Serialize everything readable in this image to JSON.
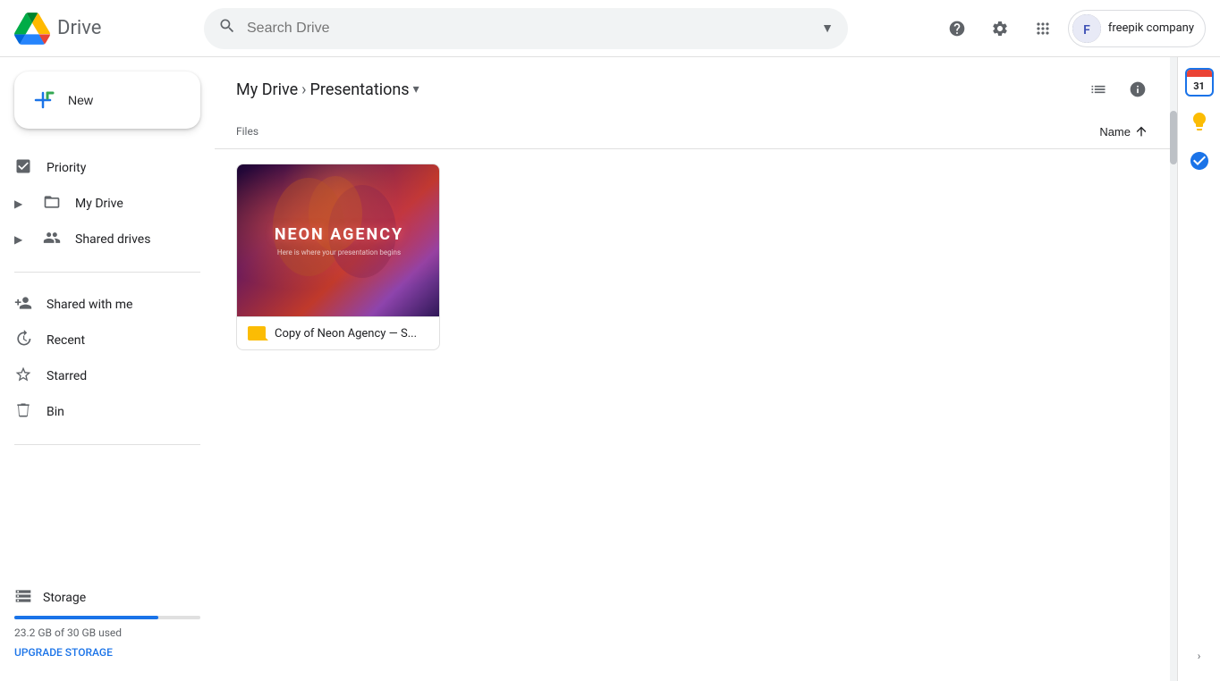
{
  "app": {
    "name": "Drive",
    "logo_colors": [
      "#4285F4",
      "#EA4335",
      "#FBBC04",
      "#34A853"
    ]
  },
  "topbar": {
    "search_placeholder": "Search Drive",
    "help_icon": "?",
    "settings_icon": "⚙",
    "grid_icon": "⋮⋮⋮",
    "user_brand": "freepik company"
  },
  "sidebar": {
    "new_label": "New",
    "nav_items": [
      {
        "id": "priority",
        "label": "Priority",
        "icon": "☑"
      },
      {
        "id": "my-drive",
        "label": "My Drive",
        "icon": "🖴",
        "expandable": true
      },
      {
        "id": "shared-drives",
        "label": "Shared drives",
        "icon": "👥",
        "expandable": true
      },
      {
        "id": "shared-with-me",
        "label": "Shared with me",
        "icon": "👤"
      },
      {
        "id": "recent",
        "label": "Recent",
        "icon": "🕐"
      },
      {
        "id": "starred",
        "label": "Starred",
        "icon": "☆"
      },
      {
        "id": "bin",
        "label": "Bin",
        "icon": "🗑"
      }
    ],
    "storage": {
      "label": "Storage",
      "used": "23.2 GB of 30 GB used",
      "used_gb": 23.2,
      "total_gb": 30,
      "upgrade_label": "UPGRADE STORAGE"
    }
  },
  "breadcrumb": {
    "parent": "My Drive",
    "current": "Presentations"
  },
  "content": {
    "files_label": "Files",
    "sort_label": "Name",
    "sort_asc": true,
    "files": [
      {
        "id": "neon-agency",
        "name": "Copy of Neon Agency — S...",
        "type": "slides",
        "thumbnail_title": "NEON AGENCY",
        "thumbnail_subtitle": "Here is where your presentation begins"
      }
    ]
  },
  "right_sidebar": {
    "list_view_title": "Switch to list view",
    "info_title": "View details",
    "expand_label": ">"
  },
  "far_right_widgets": [
    {
      "id": "calendar",
      "icon": "31",
      "type": "calendar",
      "color": "#1a73e8"
    },
    {
      "id": "keep",
      "icon": "💡",
      "color": "#fbbc04"
    },
    {
      "id": "tasks",
      "icon": "✓",
      "color": "#1a73e8"
    }
  ]
}
